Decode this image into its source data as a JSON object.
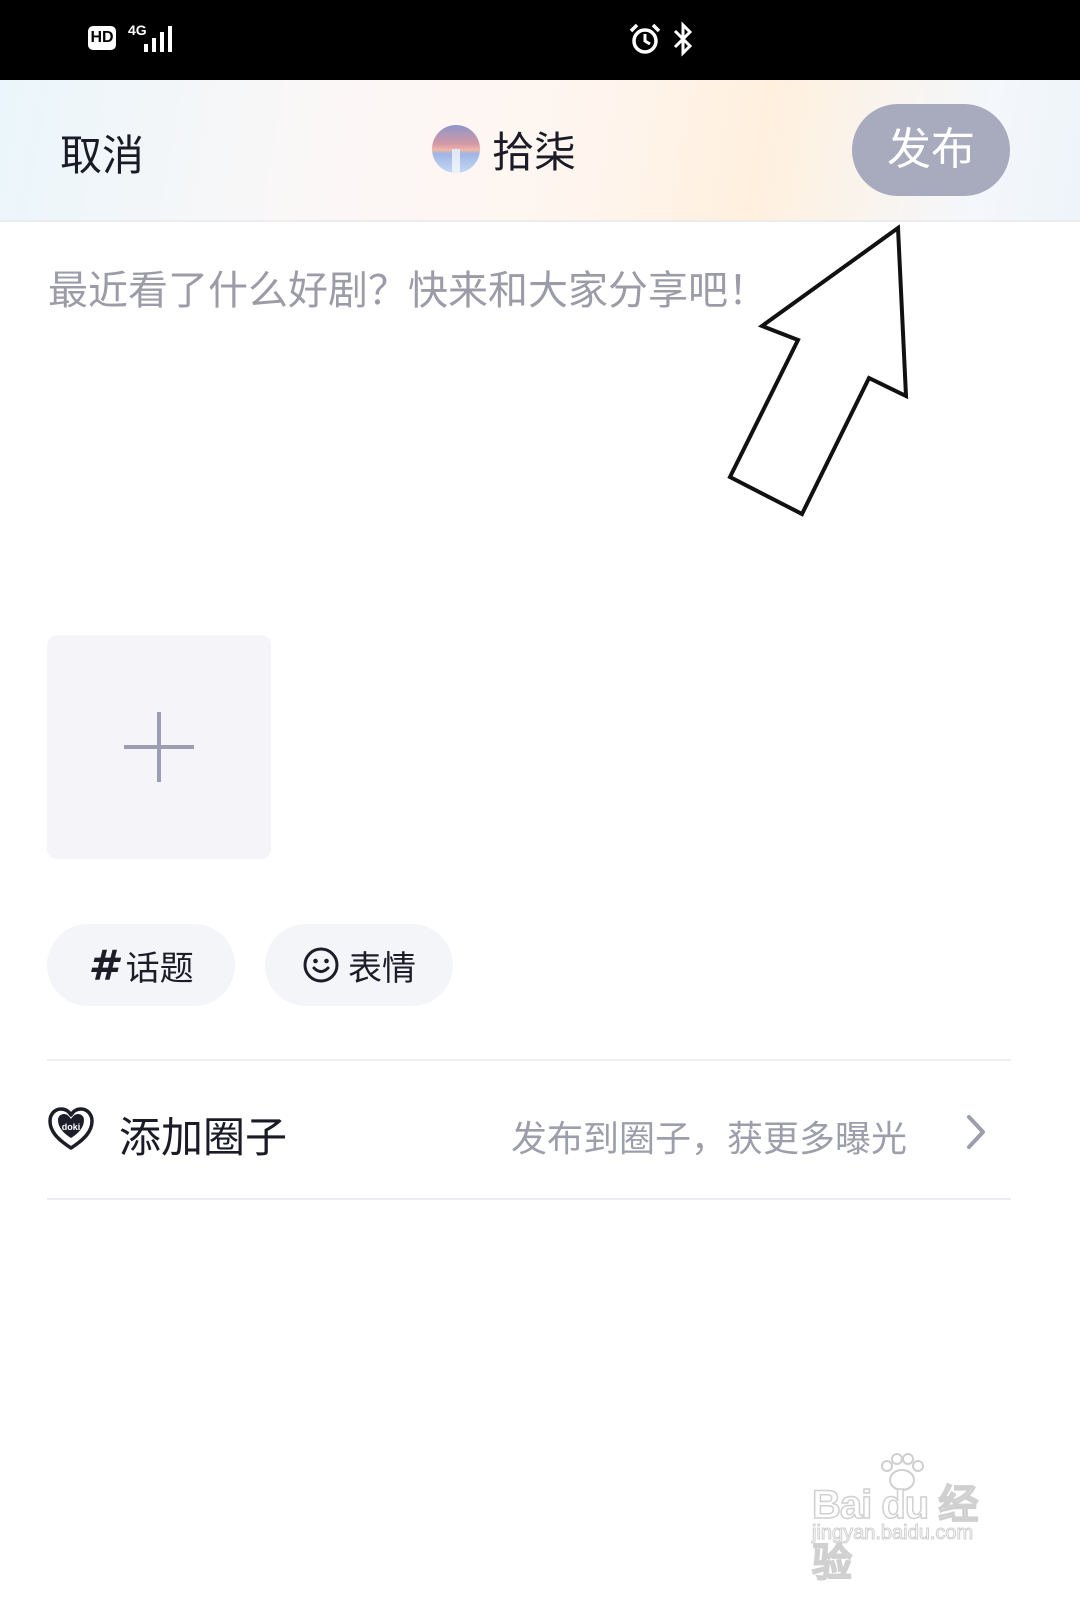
{
  "status_bar": {
    "hd_badge": "HD",
    "network": "4G",
    "icons": [
      "signal-icon",
      "alarm-icon",
      "bluetooth-icon"
    ]
  },
  "header": {
    "cancel_label": "取消",
    "username": "拾柒",
    "publish_label": "发布"
  },
  "composer": {
    "placeholder": "最近看了什么好剧？快来和大家分享吧！",
    "value": ""
  },
  "media": {
    "add_icon": "plus-icon"
  },
  "chips": {
    "topic_label": "话题",
    "emoji_label": "表情"
  },
  "circle": {
    "title": "添加圈子",
    "hint": "发布到圈子，获更多曝光",
    "icon_text": "doki"
  },
  "watermark": {
    "brand": "Bai du 经验",
    "url": "jingyan.baidu.com"
  },
  "colors": {
    "publish_bg": "#a8aabd",
    "chip_bg": "#f4f5f8",
    "hint_text": "#9d9eab",
    "placeholder_text": "#9c9ca8"
  }
}
